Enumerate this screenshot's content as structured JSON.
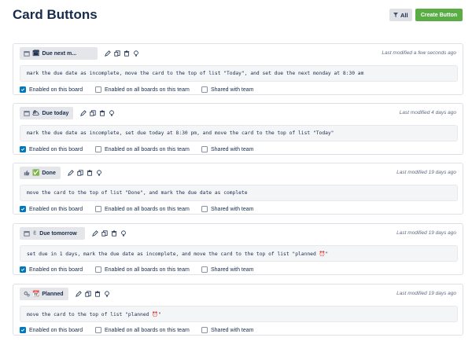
{
  "header": {
    "title": "Card Buttons",
    "filter_label": "All",
    "create_label": "Create Button"
  },
  "options": {
    "enabled_board": "Enabled on this board",
    "enabled_team": "Enabled on all boards on this team",
    "shared": "Shared with team"
  },
  "buttons": [
    {
      "type_icon": "calendar-icon",
      "emoji": "🗓",
      "name": "Due next m...",
      "modified": "Last modified a few seconds ago",
      "command": "mark the due date as incomplete, move the card to the top of list \"Today\", and set due the next monday at 8:30 am",
      "enabled_board": true,
      "enabled_team": false,
      "shared": false
    },
    {
      "type_icon": "calendar-icon",
      "emoji": "🌥",
      "name": "Due today",
      "modified": "Last modified 4 days ago",
      "command": "mark the due date as incomplete, set due today at 8:30 pm, and move the card to the top of list \"Today\"",
      "enabled_board": true,
      "enabled_team": false,
      "shared": false
    },
    {
      "type_icon": "thumbs-up-icon",
      "emoji": "✅",
      "name": "Done",
      "modified": "Last modified 19 days ago",
      "command": "move the card to the top of list \"Done\", and mark the due date as complete",
      "enabled_board": true,
      "enabled_team": false,
      "shared": false
    },
    {
      "type_icon": "calendar-icon",
      "emoji": "✌",
      "name": "Due tomorrow",
      "modified": "Last modified 19 days ago",
      "command": "set due in 1 days, mark the due date as incomplete, and move the card to the top of list \"planned ⏰\"",
      "enabled_board": true,
      "enabled_team": false,
      "shared": false
    },
    {
      "type_icon": "gears-icon",
      "emoji": "📆",
      "name": "Planned",
      "modified": "Last modified 19 days ago",
      "command": "move the card to the top of list \"planned ⏰\"",
      "enabled_board": true,
      "enabled_team": false,
      "shared": false
    }
  ],
  "colors": {
    "accent": "#5aac44",
    "checkbox": "#0079bf",
    "text": "#172b4d",
    "muted": "#5e6c84"
  }
}
